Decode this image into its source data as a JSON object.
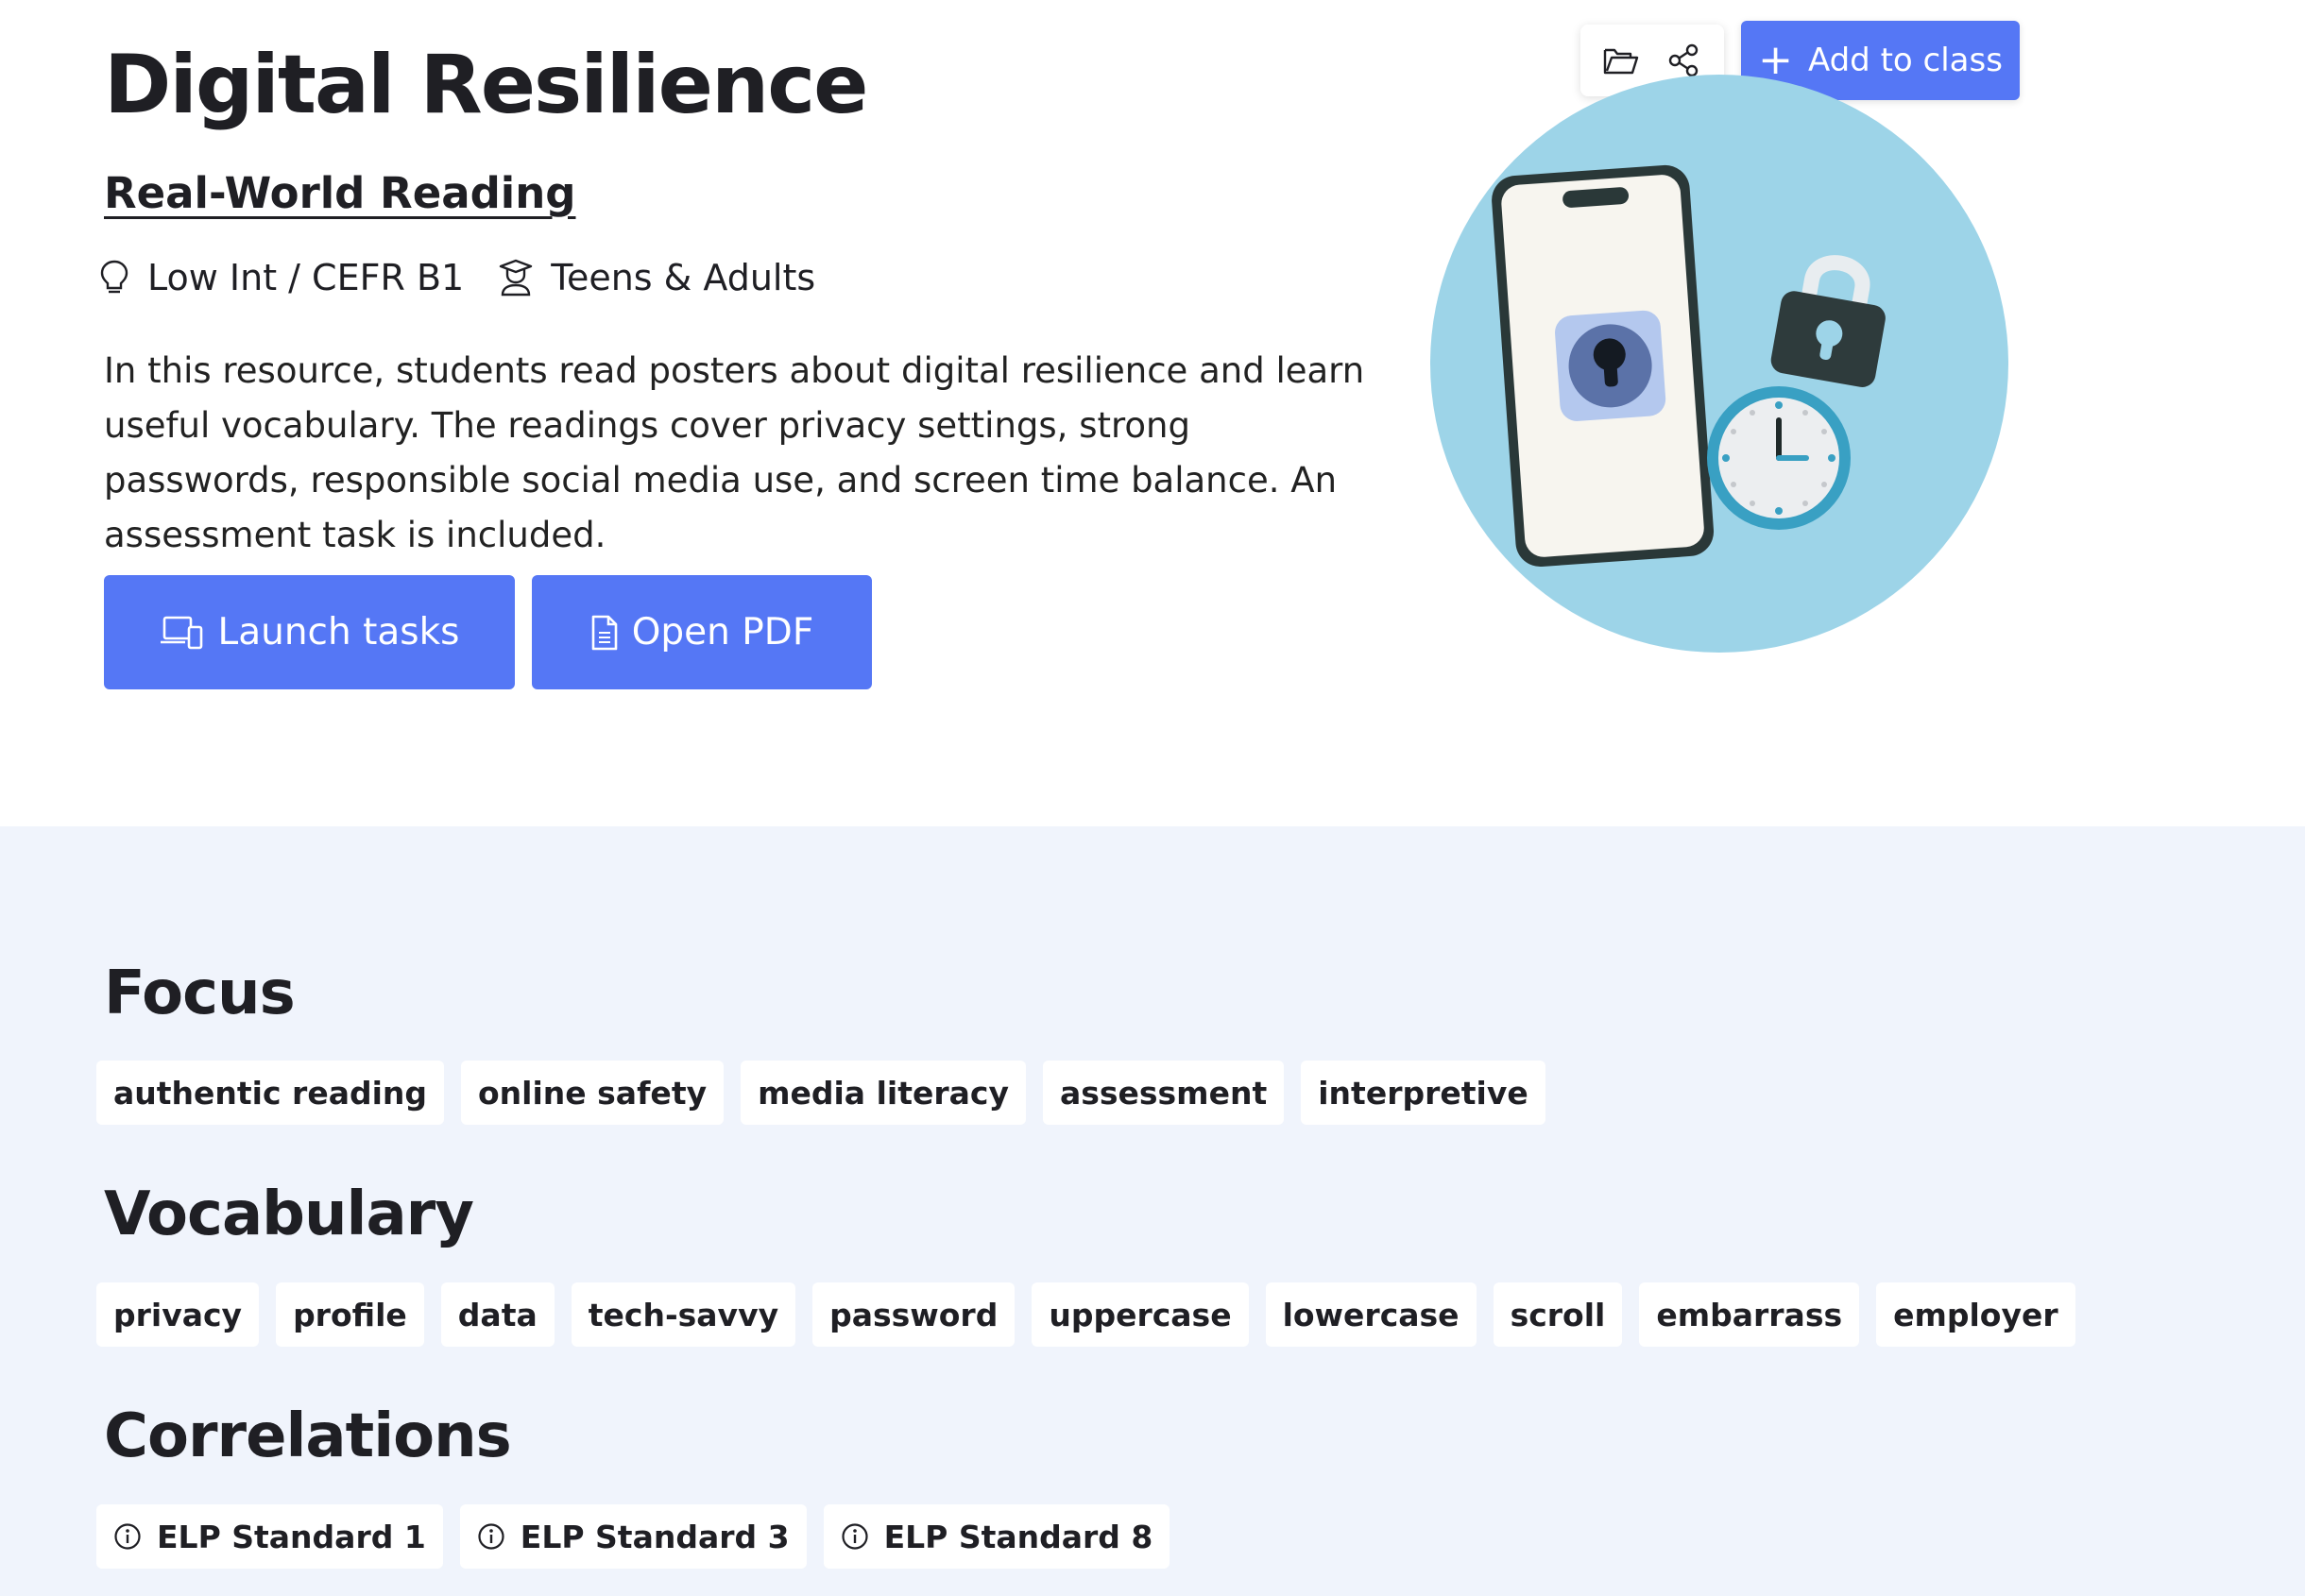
{
  "header": {
    "title": "Digital Resilience",
    "subtitle": "Real-World Reading",
    "level": "Low Int / CEFR B1",
    "audience": "Teens & Adults",
    "description": "In this resource, students read posters about digital resilience and learn useful vocabulary. The readings cover privacy settings, strong passwords, responsible social media use, and screen time balance. An assessment task is included."
  },
  "actions": {
    "launch_label": "Launch tasks",
    "pdf_label": "Open PDF",
    "add_label": "Add to class"
  },
  "toolbar_icons": [
    "folder-icon",
    "share-icon"
  ],
  "focus": {
    "heading": "Focus",
    "tags": [
      "authentic reading",
      "online safety",
      "media literacy",
      "assessment",
      "interpretive"
    ]
  },
  "vocabulary": {
    "heading": "Vocabulary",
    "words": [
      "privacy",
      "profile",
      "data",
      "tech-savvy",
      "password",
      "uppercase",
      "lowercase",
      "scroll",
      "embarrass",
      "employer"
    ]
  },
  "correlations": {
    "heading": "Correlations",
    "standards": [
      "ELP Standard 1",
      "ELP Standard 3",
      "ELP Standard 8"
    ]
  },
  "colors": {
    "accent": "#5577f5",
    "section_bg": "#f0f4fc",
    "illustration_circle": "#9dd4e8"
  }
}
